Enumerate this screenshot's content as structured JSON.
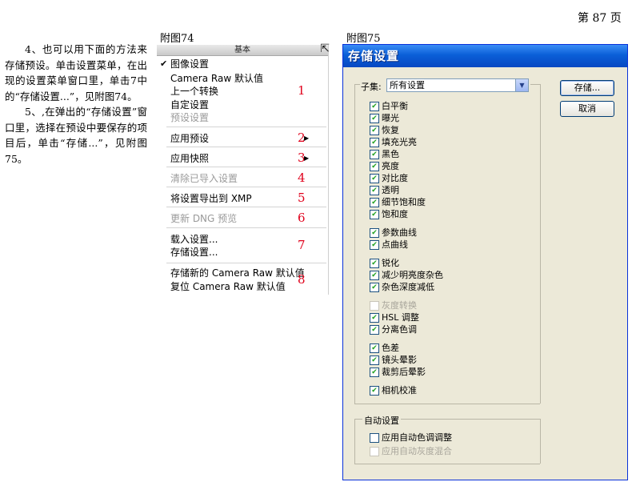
{
  "page_number": "第 87 页",
  "body_text": {
    "para1": "4、也可以用下面的方法来存储预设。单击设置菜单，在出现的设置菜单窗口里，单击7中的“存储设置...”，见附图74。",
    "para2": "5、,在弹出的“存储设置”窗口里，选择在预设中要保存的项目后，单击“存储...”，见附图75。"
  },
  "fig74": {
    "caption": "附图74",
    "header": "基本",
    "items": [
      {
        "label": "图像设置",
        "checked": true,
        "enabled": true
      },
      {
        "label": "Camera Raw 默认值",
        "enabled": true
      },
      {
        "label": "上一个转换",
        "enabled": true
      },
      {
        "label": "自定设置",
        "enabled": true
      },
      {
        "label": "预设设置",
        "enabled": false
      },
      {
        "label": "应用预设",
        "enabled": true,
        "submenu": true
      },
      {
        "label": "应用快照",
        "enabled": true,
        "submenu": true
      },
      {
        "label": "清除已导入设置",
        "enabled": false
      },
      {
        "label": "将设置导出到 XMP",
        "enabled": true
      },
      {
        "label": "更新 DNG 预览",
        "enabled": false
      },
      {
        "label": "载入设置...",
        "enabled": true
      },
      {
        "label": "存储设置...",
        "enabled": true
      },
      {
        "label": "存储新的 Camera Raw 默认值",
        "enabled": true
      },
      {
        "label": "复位 Camera Raw 默认值",
        "enabled": true
      }
    ],
    "numbers": [
      "1",
      "2",
      "3",
      "4",
      "5",
      "6",
      "7",
      "8"
    ],
    "number_color": "#e0001b"
  },
  "fig75": {
    "caption": "附图75",
    "title": "存储设置",
    "subset_label": "子集:",
    "subset_value": "所有设置",
    "save_button": "存储...",
    "cancel_button": "取消",
    "checkboxes": [
      {
        "label": "白平衡",
        "checked": true,
        "enabled": true
      },
      {
        "label": "曝光",
        "checked": true,
        "enabled": true
      },
      {
        "label": "恢复",
        "checked": true,
        "enabled": true
      },
      {
        "label": "填充光亮",
        "checked": true,
        "enabled": true
      },
      {
        "label": "黑色",
        "checked": true,
        "enabled": true
      },
      {
        "label": "亮度",
        "checked": true,
        "enabled": true
      },
      {
        "label": "对比度",
        "checked": true,
        "enabled": true
      },
      {
        "label": "透明",
        "checked": true,
        "enabled": true
      },
      {
        "label": "细节饱和度",
        "checked": true,
        "enabled": true
      },
      {
        "label": "饱和度",
        "checked": true,
        "enabled": true
      },
      {
        "label": "参数曲线",
        "checked": true,
        "enabled": true
      },
      {
        "label": "点曲线",
        "checked": true,
        "enabled": true
      },
      {
        "label": "锐化",
        "checked": true,
        "enabled": true
      },
      {
        "label": "减少明亮度杂色",
        "checked": true,
        "enabled": true
      },
      {
        "label": "杂色深度减低",
        "checked": true,
        "enabled": true
      },
      {
        "label": "灰度转换",
        "checked": false,
        "enabled": false
      },
      {
        "label": "HSL 调整",
        "checked": true,
        "enabled": true
      },
      {
        "label": "分离色调",
        "checked": true,
        "enabled": true
      },
      {
        "label": "色差",
        "checked": true,
        "enabled": true
      },
      {
        "label": "镜头晕影",
        "checked": true,
        "enabled": true
      },
      {
        "label": "裁剪后晕影",
        "checked": true,
        "enabled": true
      },
      {
        "label": "相机校准",
        "checked": true,
        "enabled": true
      }
    ],
    "auto_group_label": "自动设置",
    "auto_checkboxes": [
      {
        "label": "应用自动色调调整",
        "checked": false,
        "enabled": true
      },
      {
        "label": "应用自动灰度混合",
        "checked": false,
        "enabled": false
      }
    ],
    "check_color": "#21a121",
    "titlebar_color": "#0a5fd8"
  }
}
